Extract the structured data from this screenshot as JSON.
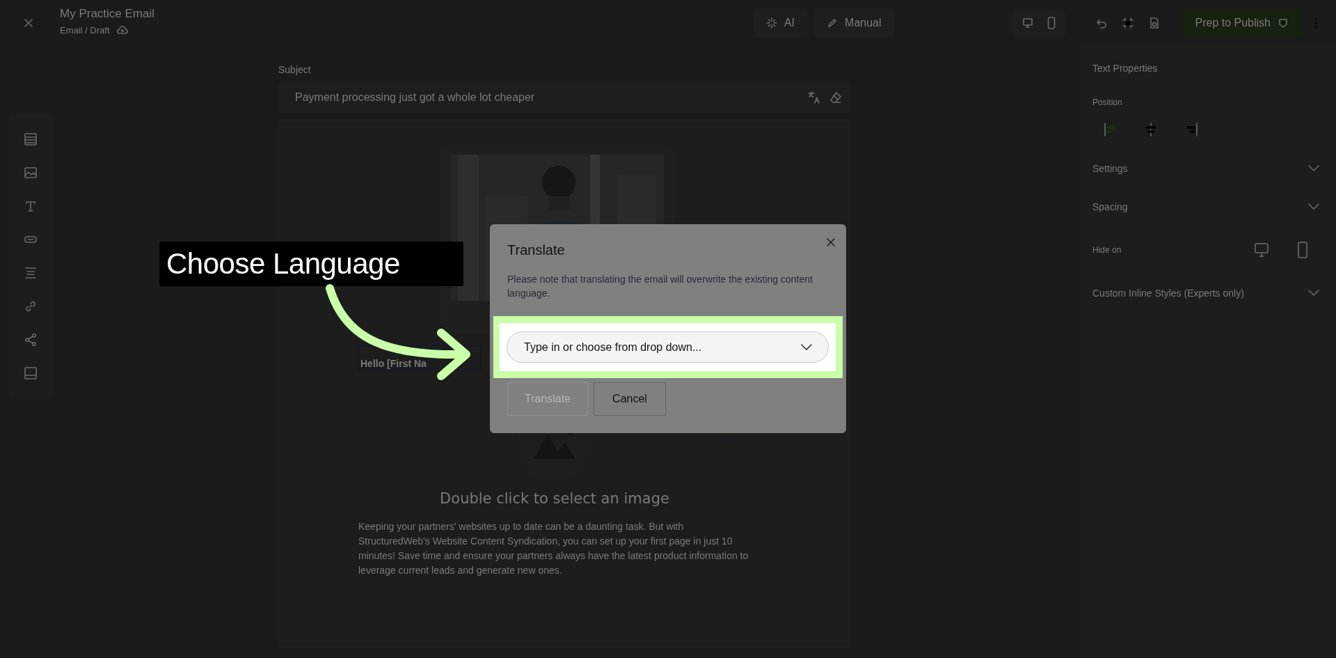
{
  "header": {
    "title": "My Practice Email",
    "breadcrumb": "Email / Draft"
  },
  "modes": [
    {
      "kind": "ai",
      "label": "AI"
    },
    {
      "kind": "manual",
      "label": "Manual"
    }
  ],
  "publish_button": "Prep to Publish",
  "subject": {
    "label": "Subject",
    "value": "Payment processing just got a whole lot cheaper"
  },
  "email": {
    "greeting": "Hello [First Na",
    "image_placeholder": "Double click to select an image",
    "body": "Keeping your partners' websites up to date can be a daunting task. But with StructuredWeb's Website Content Syndication, you can set up your first page in just 10 minutes! Save time and ensure your partners always have the latest product information to leverage current leads and generate new ones."
  },
  "properties": {
    "title": "Text Properties",
    "position_label": "Position",
    "position_options": [
      {
        "kind": "left",
        "selected": true
      },
      {
        "kind": "center",
        "selected": false
      },
      {
        "kind": "right",
        "selected": false
      }
    ],
    "sections": [
      {
        "kind": "section",
        "label": "Settings",
        "expanded": false
      },
      {
        "kind": "section",
        "label": "Spacing",
        "expanded": false
      },
      {
        "kind": "hide",
        "label": "Hide on"
      },
      {
        "kind": "section",
        "label": "Custom Inline Styles (Experts only)",
        "expanded": false
      }
    ]
  },
  "dialog": {
    "title": "Translate",
    "note": "Please note that translating the email will overwrite the existing content language.",
    "select": {
      "placeholder": "Type in or choose from drop down..."
    },
    "buttons": [
      {
        "label": "Translate",
        "disabled": true
      },
      {
        "label": "Cancel",
        "disabled": false
      }
    ]
  },
  "annotation": {
    "label": "Choose Language"
  }
}
